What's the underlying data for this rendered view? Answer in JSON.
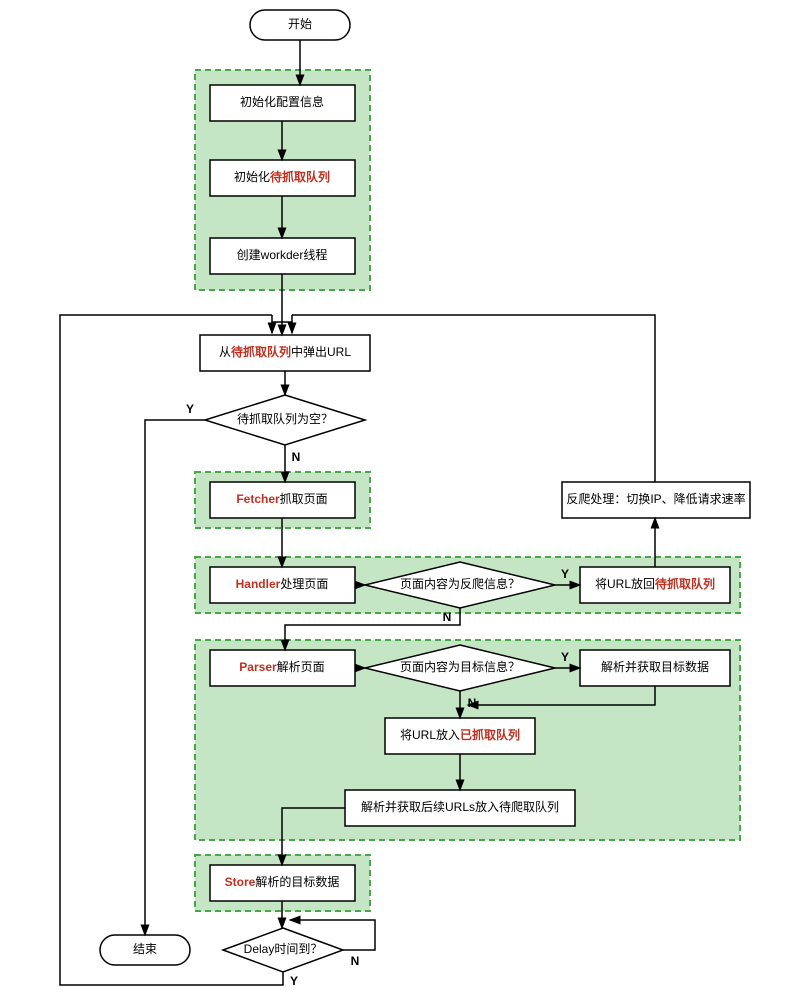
{
  "nodes": {
    "start": "开始",
    "init_cfg": "初始化配置信息",
    "init_queue_pre": "初始化",
    "init_queue_red": "待抓取队列",
    "create_worker": "创建workder线程",
    "pop_pre": "从",
    "pop_red": "待抓取队列",
    "pop_post": "中弹出URL",
    "d_empty": "待抓取队列为空？",
    "fetcher_red": "Fetcher",
    "fetcher_post": "抓取页面",
    "handler_red": "Handler",
    "handler_post": "处理页面",
    "d_anti": "页面内容为反爬信息？",
    "put_back_pre": "将URL放回",
    "put_back_red": "待抓取队列",
    "anti_handle": "反爬处理：切换IP、降低请求速率",
    "parser_red": "Parser",
    "parser_post": "解析页面",
    "d_target": "页面内容为目标信息？",
    "get_target": "解析并获取目标数据",
    "put_done_pre": "将URL放入",
    "put_done_red": "已抓取队列",
    "parse_next": "解析并获取后续URLs放入待爬取队列",
    "store_red": "Store",
    "store_post": "解析的目标数据",
    "d_delay": "Delay时间到？",
    "end": "结束"
  },
  "labels": {
    "Y": "Y",
    "N": "N"
  }
}
